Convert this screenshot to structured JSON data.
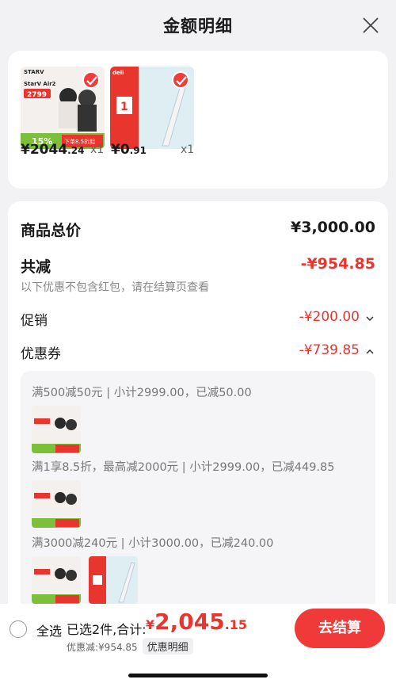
{
  "header": {
    "title": "金额明细"
  },
  "products": [
    {
      "price_int": "¥2044",
      "price_dec": ".24",
      "qty": "x1",
      "brand": "STARV",
      "image_line1": "StarV Air2",
      "image_price": "2799",
      "image_discount": "15%",
      "image_tag": "下单8.5折起"
    },
    {
      "price_int": "¥0",
      "price_dec": ".91",
      "qty": "x1",
      "brand": "deli",
      "image_num": "1"
    }
  ],
  "summary": {
    "total_label": "商品总价",
    "total_value": "¥3,000.00",
    "reduce_label": "共减",
    "reduce_value": "-¥954.85",
    "note": "以下优惠不包含红包，请在结算页查看",
    "promo_label": "促销",
    "promo_value": "-¥200.00",
    "coupon_label": "优惠券",
    "coupon_value": "-¥739.85"
  },
  "coupons": [
    {
      "text": "满500减50元 | 小计2999.00，已减50.00"
    },
    {
      "text": "满1享8.5折，最高减2000元 | 小计2999.00，已减449.85"
    },
    {
      "text": "满3000减240元 | 小计3000.00，已减240.00"
    }
  ],
  "bottom": {
    "select_all": "全选",
    "selected": "已选2件,合计:",
    "currency": "¥",
    "total_int": "2,045",
    "total_dec": ".15",
    "discount": "优惠减:¥954.85",
    "detail_link": "优惠明细",
    "checkout": "去结算"
  },
  "colors": {
    "accent": "#e8352e",
    "button": "#f03a3a"
  }
}
